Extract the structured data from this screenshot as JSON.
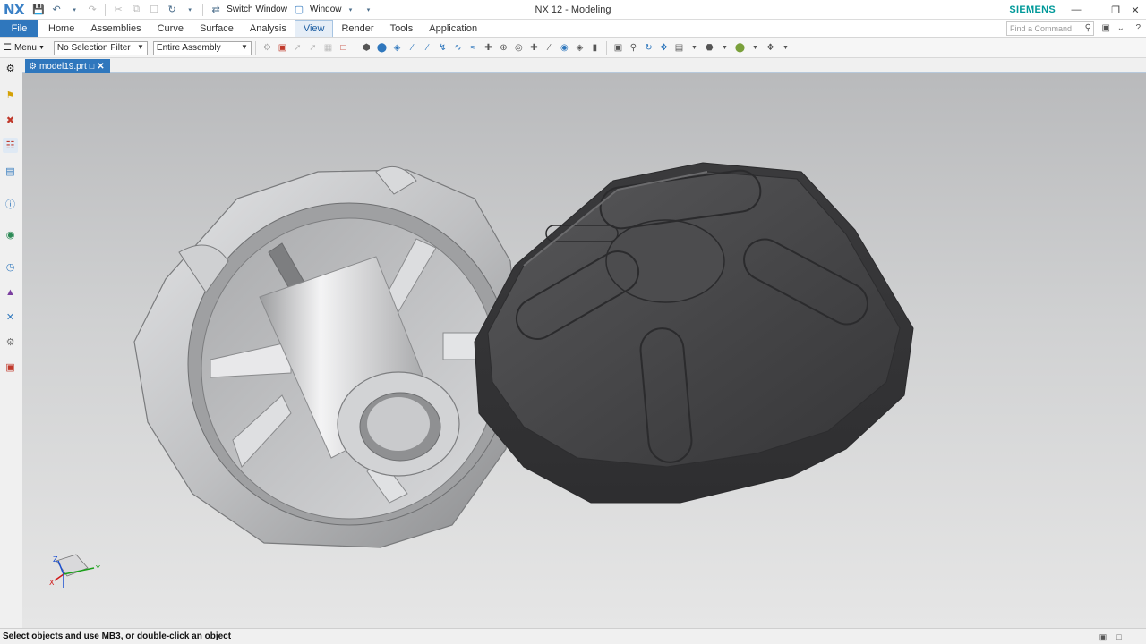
{
  "app": {
    "logo": "NX",
    "title": "NX 12 - Modeling",
    "brand": "SIEMENS",
    "quick_access": {
      "switch_window": "Switch Window",
      "window": "Window"
    }
  },
  "ribbon": {
    "file": "File",
    "tabs": [
      "Home",
      "Assemblies",
      "Curve",
      "Surface",
      "Analysis",
      "View",
      "Render",
      "Tools",
      "Application"
    ],
    "active_tab": "View",
    "find_placeholder": "Find a Command"
  },
  "toolbar": {
    "menu_label": "Menu",
    "selection_filter": "No Selection Filter",
    "scope": "Entire Assembly"
  },
  "document": {
    "tab_label": "model19.prt"
  },
  "status": {
    "prompt": "Select objects and use MB3, or double-click an object"
  },
  "colors": {
    "accent": "#2f77bd",
    "brand": "#009999",
    "background_top": "#b9babc",
    "background_bottom": "#e6e6e6",
    "light_part": "#c7c8ca",
    "dark_part": "#4a4a4c"
  },
  "triad": {
    "x": "X",
    "y": "Y",
    "z": "Z"
  }
}
